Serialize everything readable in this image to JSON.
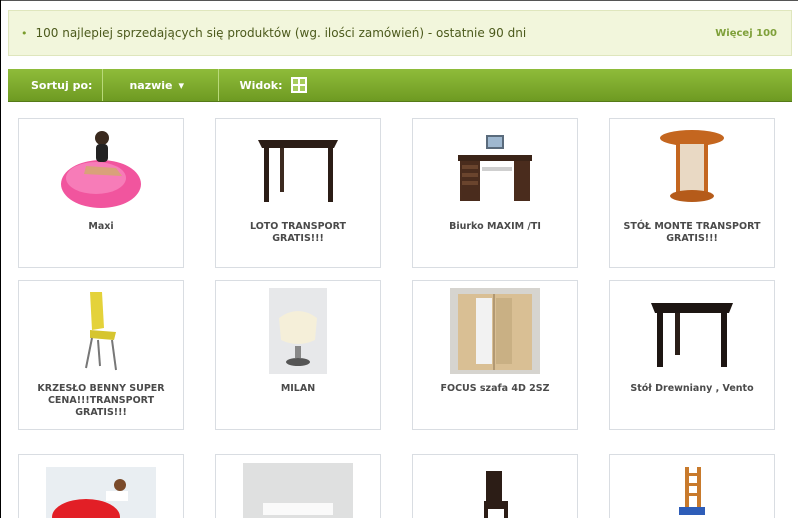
{
  "header": {
    "title": "100 najlepiej sprzedających się produktów (wg. ilości zamówień) - ostatnie 90 dni",
    "more_link": "Więcej 100"
  },
  "toolbar": {
    "sort_label": "Sortuj po:",
    "sort_value": "nazwie",
    "view_label": "Widok:"
  },
  "products": [
    {
      "name": "Maxi"
    },
    {
      "name": "LOTO TRANSPORT GRATIS!!!"
    },
    {
      "name": "Biurko MAXIM /TI"
    },
    {
      "name": "STÓŁ MONTE TRANSPORT GRATIS!!!"
    },
    {
      "name": "KRZESŁO BENNY SUPER CENA!!!TRANSPORT GRATIS!!!"
    },
    {
      "name": "MILAN"
    },
    {
      "name": "FOCUS szafa 4D 2SZ"
    },
    {
      "name": "Stół Drewniany , Vento"
    },
    {
      "name": ""
    },
    {
      "name": ""
    },
    {
      "name": ""
    },
    {
      "name": ""
    }
  ],
  "colors": {
    "toolbar_green": "#7aa82c",
    "header_bg": "#f2f6dc",
    "accent_text": "#7fa03a"
  }
}
